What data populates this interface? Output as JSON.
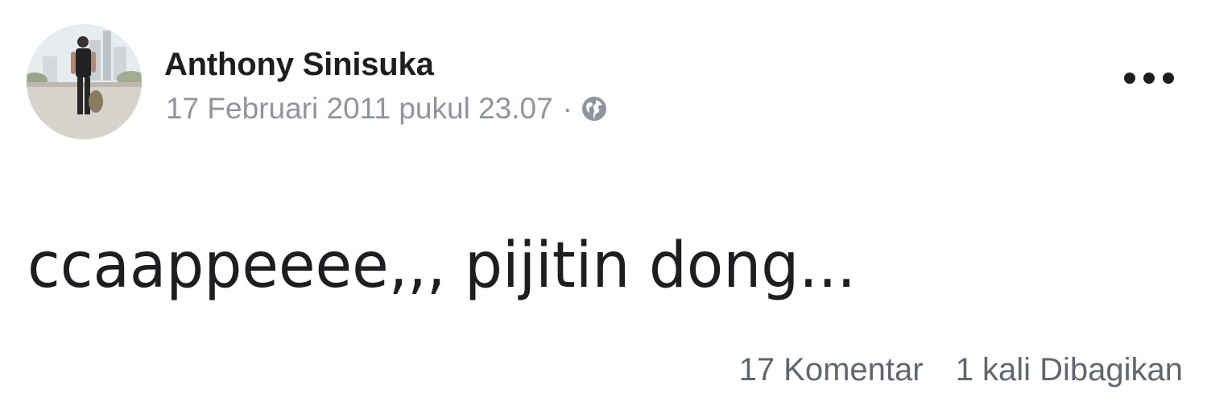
{
  "post": {
    "author_name": "Anthony Sinisuka",
    "timestamp": "17 Februari 2011 pukul 23.07",
    "meta_separator": "·",
    "privacy_icon": "globe-icon",
    "more_icon": "more-dots-icon",
    "text": "ccaappeeee,,, pijitin dong...",
    "comments_label": "17 Komentar",
    "shares_label": "1 kali Dibagikan"
  },
  "colors": {
    "name": "#1c1e21",
    "meta": "#90949c",
    "stats": "#606770",
    "background": "#ffffff"
  }
}
